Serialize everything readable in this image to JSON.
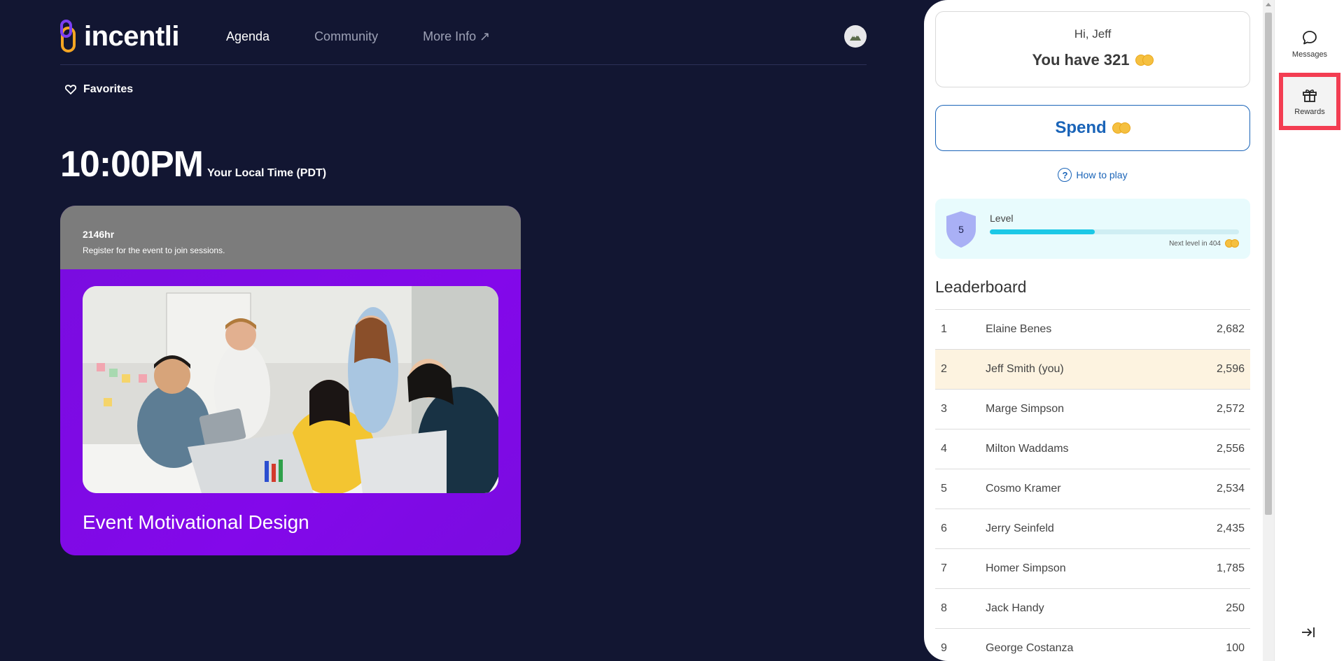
{
  "brand": {
    "name": "incentli"
  },
  "nav": [
    {
      "label": "Agenda",
      "active": true
    },
    {
      "label": "Community",
      "active": false
    },
    {
      "label": "More Info ↗",
      "active": false
    }
  ],
  "favorites": {
    "label": "Favorites"
  },
  "clock": {
    "time": "10:00PM",
    "zone_label": "Your Local Time (PDT)"
  },
  "event": {
    "hours": "2146hr",
    "note": "Register for the event to join sessions.",
    "title": "Event Motivational Design"
  },
  "wallet": {
    "greeting": "Hi, Jeff",
    "balance_text": "You have 321",
    "spend_label": "Spend",
    "howto_label": "How to play"
  },
  "level": {
    "number": "5",
    "label": "Level",
    "progress": 0.42,
    "next_text": "Next level in 404"
  },
  "leaderboard": {
    "title": "Leaderboard",
    "rows": [
      {
        "rank": "1",
        "name": "Elaine Benes",
        "score": "2,682",
        "me": false
      },
      {
        "rank": "2",
        "name": "Jeff Smith (you)",
        "score": "2,596",
        "me": true
      },
      {
        "rank": "3",
        "name": "Marge Simpson",
        "score": "2,572",
        "me": false
      },
      {
        "rank": "4",
        "name": "Milton Waddams",
        "score": "2,556",
        "me": false
      },
      {
        "rank": "5",
        "name": "Cosmo Kramer",
        "score": "2,534",
        "me": false
      },
      {
        "rank": "6",
        "name": "Jerry Seinfeld",
        "score": "2,435",
        "me": false
      },
      {
        "rank": "7",
        "name": "Homer Simpson",
        "score": "1,785",
        "me": false
      },
      {
        "rank": "8",
        "name": "Jack Handy",
        "score": "250",
        "me": false
      },
      {
        "rank": "9",
        "name": "George Costanza",
        "score": "100",
        "me": false
      }
    ]
  },
  "rail": {
    "messages_label": "Messages",
    "rewards_label": "Rewards"
  },
  "colors": {
    "background": "#121632",
    "event_purple": "#7a0ce0",
    "accent_blue": "#1a64b8",
    "level_cyan": "#1cc8e6",
    "highlight_red": "#f33d52"
  }
}
